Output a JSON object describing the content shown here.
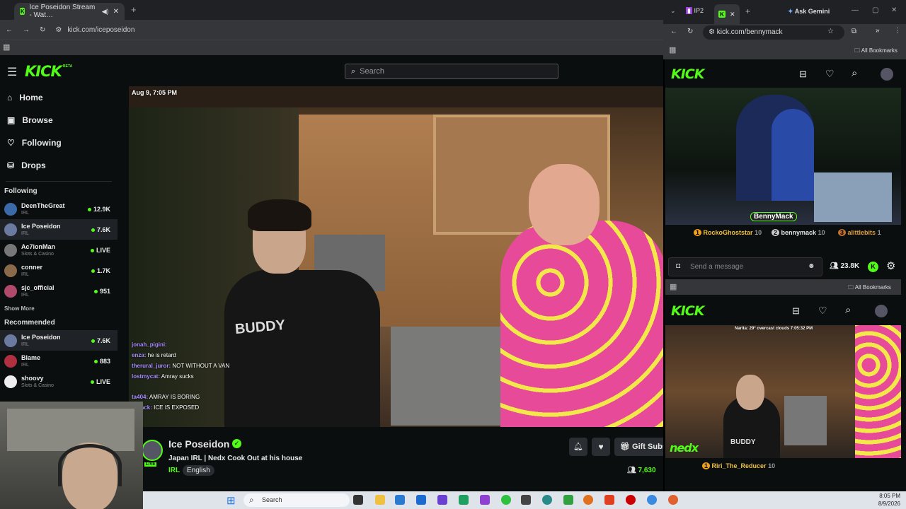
{
  "left_browser": {
    "tab_title": "Ice Poseidon Stream - Wat…",
    "url": "kick.com/iceposeidon"
  },
  "kick": {
    "logo": "KICK",
    "beta": "BETA",
    "search_placeholder": "Search",
    "nav": [
      {
        "label": "Home"
      },
      {
        "label": "Browse"
      },
      {
        "label": "Following"
      },
      {
        "label": "Drops"
      }
    ],
    "following_title": "Following",
    "following": [
      {
        "name": "DeenTheGreat",
        "category": "IRL",
        "viewers": "12.9K"
      },
      {
        "name": "Ice Poseidon",
        "category": "IRL",
        "viewers": "7.6K"
      },
      {
        "name": "Ac7ionMan",
        "category": "Slots & Casino",
        "viewers": "LIVE"
      },
      {
        "name": "conner",
        "category": "IRL",
        "viewers": "1.7K"
      },
      {
        "name": "sjc_official",
        "category": "IRL",
        "viewers": "951"
      }
    ],
    "show_more": "Show More",
    "recommended_title": "Recommended",
    "recommended": [
      {
        "name": "Ice Poseidon",
        "category": "IRL",
        "viewers": "7.6K"
      },
      {
        "name": "Blame",
        "category": "IRL",
        "viewers": "883"
      },
      {
        "name": "shoovy",
        "category": "Slots & Casino",
        "viewers": "LIVE"
      }
    ]
  },
  "video": {
    "timestamp": "Aug 9, 7:05 PM",
    "overlay_chat": [
      {
        "user": "jonah_pigini:",
        "msg": ""
      },
      {
        "user": "enza:",
        "msg": "he is retard"
      },
      {
        "user": "therural_juror:",
        "msg": "NOT WITHOUT A VAN"
      },
      {
        "user": "lostmycat:",
        "msg": "Amray sucks"
      },
      {
        "user": "ta404:",
        "msg": "AMRAY IS BORING"
      },
      {
        "user": "oStack:",
        "msg": "ICE IS EXPOSED"
      }
    ],
    "shirt_text": "BUDDY"
  },
  "stream_info": {
    "streamer": "Ice Poseidon",
    "title": "Japan IRL | Nedx Cook Out at his house",
    "category": "IRL",
    "language": "English",
    "gift_label": "Gift Subs",
    "viewers": "7,630",
    "live_badge": "LIVE"
  },
  "right_browser": {
    "tab1": "IP2",
    "ask_gemini": "Ask Gemini",
    "url": "kick.com/bennymack",
    "all_bookmarks": "All Bookmarks",
    "stream1_overlay": "BennyMack",
    "leaderboard": [
      {
        "rank": "1",
        "name": "RockoGhoststar",
        "value": "10"
      },
      {
        "rank": "2",
        "name": "bennymack",
        "value": "10"
      },
      {
        "rank": "3",
        "name": "alittlebits",
        "value": "1"
      }
    ],
    "message_placeholder": "Send a message",
    "viewers": "23.8K",
    "all_bookmarks2": "All Bookmarks",
    "stream2_overlay": "Narita: 29° overcast clouds 7:05:32 PM",
    "stream2_shirt": "BUDDY",
    "stream2_logo": "nedx",
    "stream2_top": {
      "rank": "1",
      "name": "Riri_The_Reducer",
      "value": "10"
    }
  },
  "taskbar": {
    "search": "Search",
    "time": "8:05 PM",
    "date": "8/9/2026"
  }
}
